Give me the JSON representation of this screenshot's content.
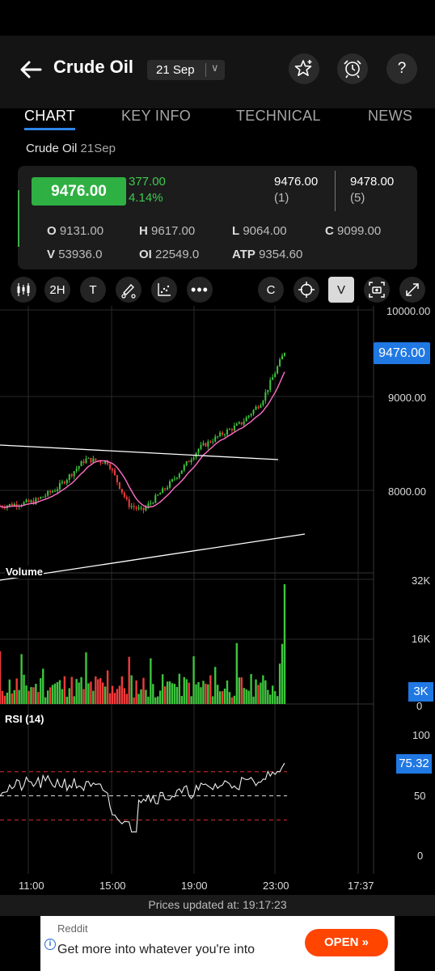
{
  "header": {
    "title": "Crude Oil",
    "expiry": "21 Sep",
    "back_icon": "arrow-left-icon",
    "icons": [
      "star-plus-icon",
      "alarm-icon",
      "help-icon"
    ]
  },
  "tabs": [
    {
      "label": "CHART",
      "active": true
    },
    {
      "label": "KEY INFO",
      "active": false
    },
    {
      "label": "TECHNICAL",
      "active": false
    },
    {
      "label": "NEWS",
      "active": false
    }
  ],
  "subtitle": {
    "name": "Crude Oil",
    "expiry": "21Sep"
  },
  "quote": {
    "ltp": "9476.00",
    "change": "377.00",
    "change_pct": "4.14%",
    "bid_price": "9476.00",
    "bid_qty": "(1)",
    "ask_price": "9478.00",
    "ask_qty": "(5)",
    "stats": {
      "open": {
        "label": "O",
        "value": "9131.00"
      },
      "high": {
        "label": "H",
        "value": "9617.00"
      },
      "low": {
        "label": "L",
        "value": "9064.00"
      },
      "close": {
        "label": "C",
        "value": "9099.00"
      },
      "volume": {
        "label": "V",
        "value": "53936.0"
      },
      "oi": {
        "label": "OI",
        "value": "22549.0"
      },
      "atp": {
        "label": "ATP",
        "value": "9354.60"
      }
    },
    "colors": {
      "up": "#3ecb4f",
      "ltp_bg": "#2fb043"
    }
  },
  "toolbar": {
    "interval": "2H",
    "text_tool": "T",
    "c_button": "C",
    "v_button": "V",
    "icons": [
      "candles-icon",
      "pen-icon",
      "scatter-icon",
      "more-icon",
      "crosshair-icon",
      "screenshot-icon",
      "fullscreen-icon"
    ]
  },
  "chart_data": {
    "type": "candlestick",
    "price_axis": [
      "10000.00",
      "9000.00",
      "8000.00"
    ],
    "last_price": "9476.00",
    "price_range": [
      7650,
      10050
    ],
    "time_axis": [
      "11:00",
      "15:00",
      "19:00",
      "23:00",
      "17:37"
    ],
    "volume_label": "Volume",
    "volume_axis": [
      "32K",
      "16K",
      "0"
    ],
    "last_volume": "3K",
    "rsi_label": "RSI (14)",
    "rsi_axis": [
      "100",
      "50",
      "0"
    ],
    "rsi_value": "75.32",
    "rsi_levels": [
      70,
      50,
      30
    ],
    "colors": {
      "up": "#3ec43e",
      "down": "#ef3b3b",
      "ma": "#ff6ec7",
      "tag": "#2078e3"
    }
  },
  "footer": {
    "label": "Prices updated at:",
    "time": "19:17:23"
  },
  "ad": {
    "source": "Reddit",
    "text": "Get more into whatever you're into",
    "button": "OPEN »"
  }
}
